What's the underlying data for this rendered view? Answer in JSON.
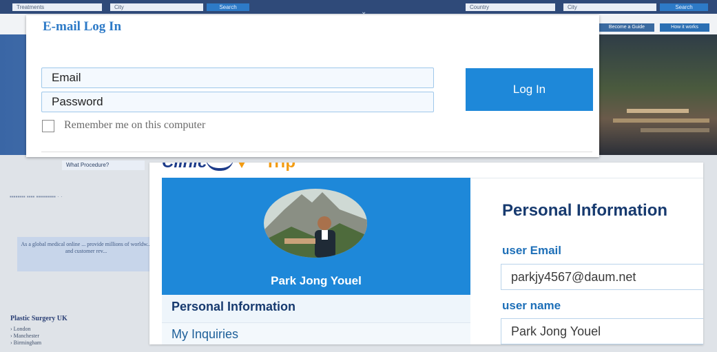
{
  "background": {
    "search_bar": {
      "fields": [
        "Treatments",
        "City",
        "Country",
        "City"
      ],
      "search_label": "Search"
    },
    "nav_buttons": [
      "Become a Guide",
      "How it works"
    ],
    "procedure_placeholder": "What Procedure?",
    "global_text": "As a global medical online ... provide millions of worldw... and customer rev...",
    "section_heading": "Plastic Surgery UK",
    "cities": [
      "London",
      "Manchester",
      "Birmingham"
    ]
  },
  "login": {
    "title": "E-mail Log In",
    "email_placeholder": "Email",
    "password_placeholder": "Password",
    "login_button": "Log In",
    "remember_label": "Remember me on this computer"
  },
  "profile": {
    "user_name": "Park Jong Youel",
    "menu": [
      "Personal Information",
      "My Inquiries"
    ],
    "section_title": "Personal Information",
    "fields": [
      {
        "label": "user Email",
        "value": "parkjy4567@daum.net"
      },
      {
        "label": "user name",
        "value": "Park Jong Youel"
      }
    ]
  },
  "colors": {
    "accent": "#1e88d9",
    "title_blue": "#2d7ac7",
    "brand_dark": "#1d3c8a"
  }
}
